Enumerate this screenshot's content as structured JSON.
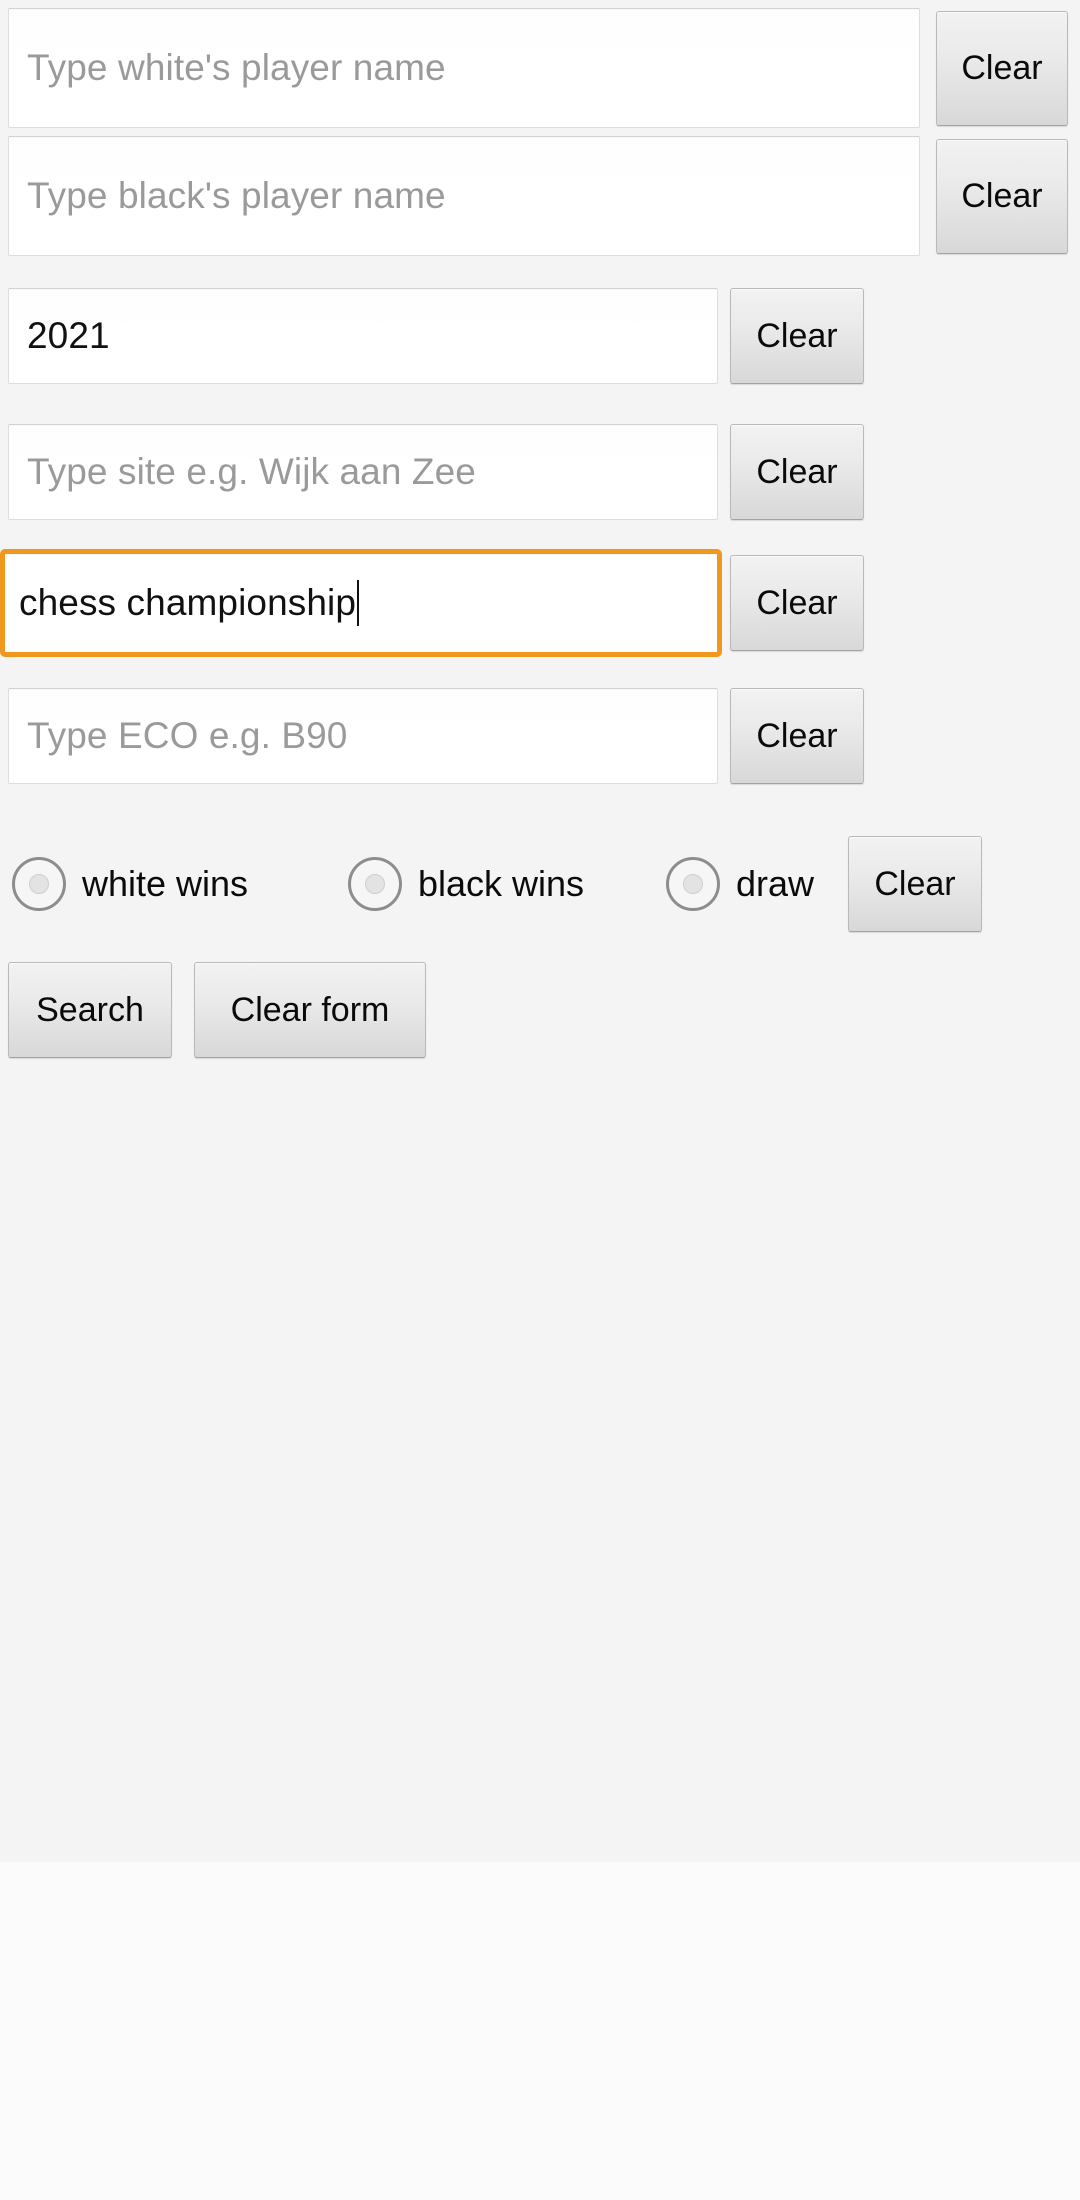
{
  "app": {
    "background_color": "#f4f4f4",
    "accent_color": "#f0971e"
  },
  "form": {
    "rows": [
      {
        "name": "white-player",
        "value": "",
        "placeholder": "Type white's player name",
        "clear_label": "Clear",
        "focused": false
      },
      {
        "name": "black-player",
        "value": "",
        "placeholder": "Type black's player name",
        "clear_label": "Clear",
        "focused": false
      },
      {
        "name": "year",
        "value": "2021",
        "placeholder": "",
        "clear_label": "Clear",
        "focused": false
      },
      {
        "name": "site",
        "value": "",
        "placeholder": "Type site e.g. Wijk aan Zee",
        "clear_label": "Clear",
        "focused": false
      },
      {
        "name": "event",
        "value": "chess championship",
        "placeholder": "",
        "clear_label": "Clear",
        "focused": true
      },
      {
        "name": "eco",
        "value": "",
        "placeholder": "Type ECO e.g. B90",
        "clear_label": "Clear",
        "focused": false
      }
    ],
    "result": {
      "options": [
        {
          "name": "white-wins",
          "label": "white wins",
          "selected": false
        },
        {
          "name": "black-wins",
          "label": "black wins",
          "selected": false
        },
        {
          "name": "draw",
          "label": "draw",
          "selected": false
        }
      ],
      "clear_label": "Clear"
    },
    "actions": {
      "search_label": "Search",
      "clear_form_label": "Clear form"
    }
  }
}
